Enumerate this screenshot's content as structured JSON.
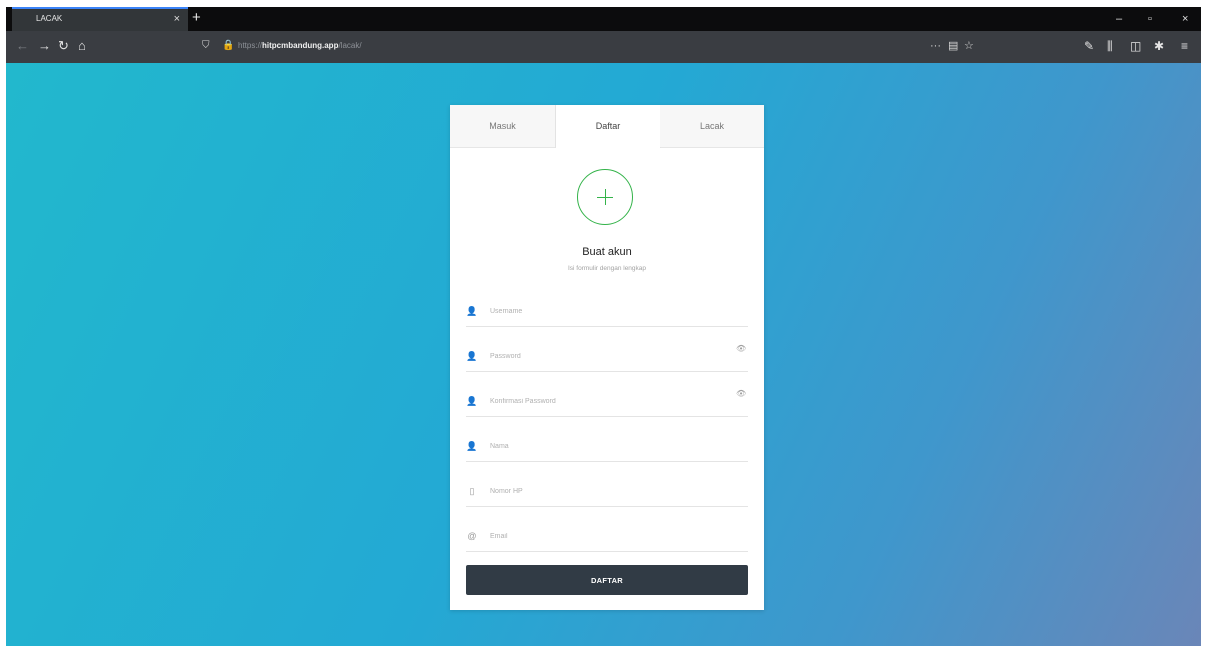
{
  "browser": {
    "tab_title": "LACAK",
    "tab_close_icon": "×",
    "new_tab_icon": "+",
    "window_controls": {
      "minimize": "–",
      "restore": "▫",
      "close": "×"
    },
    "nav": {
      "back": "←",
      "forward": "→",
      "reload": "↻",
      "home": "⌂"
    },
    "url_prefix": "https://",
    "url_host": "hitpcmbandung.app",
    "url_path": "/lacak/",
    "url_actions": {
      "more": "···",
      "reader": "▤",
      "bookmark": "☆"
    },
    "toolbar_icons": {
      "tools": "✎",
      "library": "⫼",
      "sidebar": "◫",
      "extension": "✱",
      "menu": "≡"
    }
  },
  "form": {
    "tabs": [
      {
        "label": "Masuk"
      },
      {
        "label": "Daftar"
      },
      {
        "label": "Lacak"
      }
    ],
    "active_tab": "Daftar",
    "title": "Buat akun",
    "subtitle": "Isi formulir dengan lengkap",
    "fields": [
      {
        "icon": "user-icon",
        "glyph": "👤",
        "placeholder": "Username"
      },
      {
        "icon": "user-lock-icon",
        "glyph": "👤",
        "placeholder": "Password",
        "eye_icon": "👁"
      },
      {
        "icon": "user-lock-icon",
        "glyph": "👤",
        "placeholder": "Konfirmasi Password",
        "eye_icon": "👁"
      },
      {
        "icon": "user-icon",
        "glyph": "👤",
        "placeholder": "Nama"
      },
      {
        "icon": "phone-icon",
        "glyph": "▯",
        "placeholder": "Nomor HP"
      },
      {
        "icon": "at-icon",
        "glyph": "@",
        "placeholder": "Email"
      }
    ],
    "submit_label": "DAFTAR"
  },
  "colors": {
    "accent_green": "#34b34a",
    "button_bg": "#313b45",
    "gradient_start": "#22b8cd",
    "gradient_end": "#6a86b8"
  }
}
